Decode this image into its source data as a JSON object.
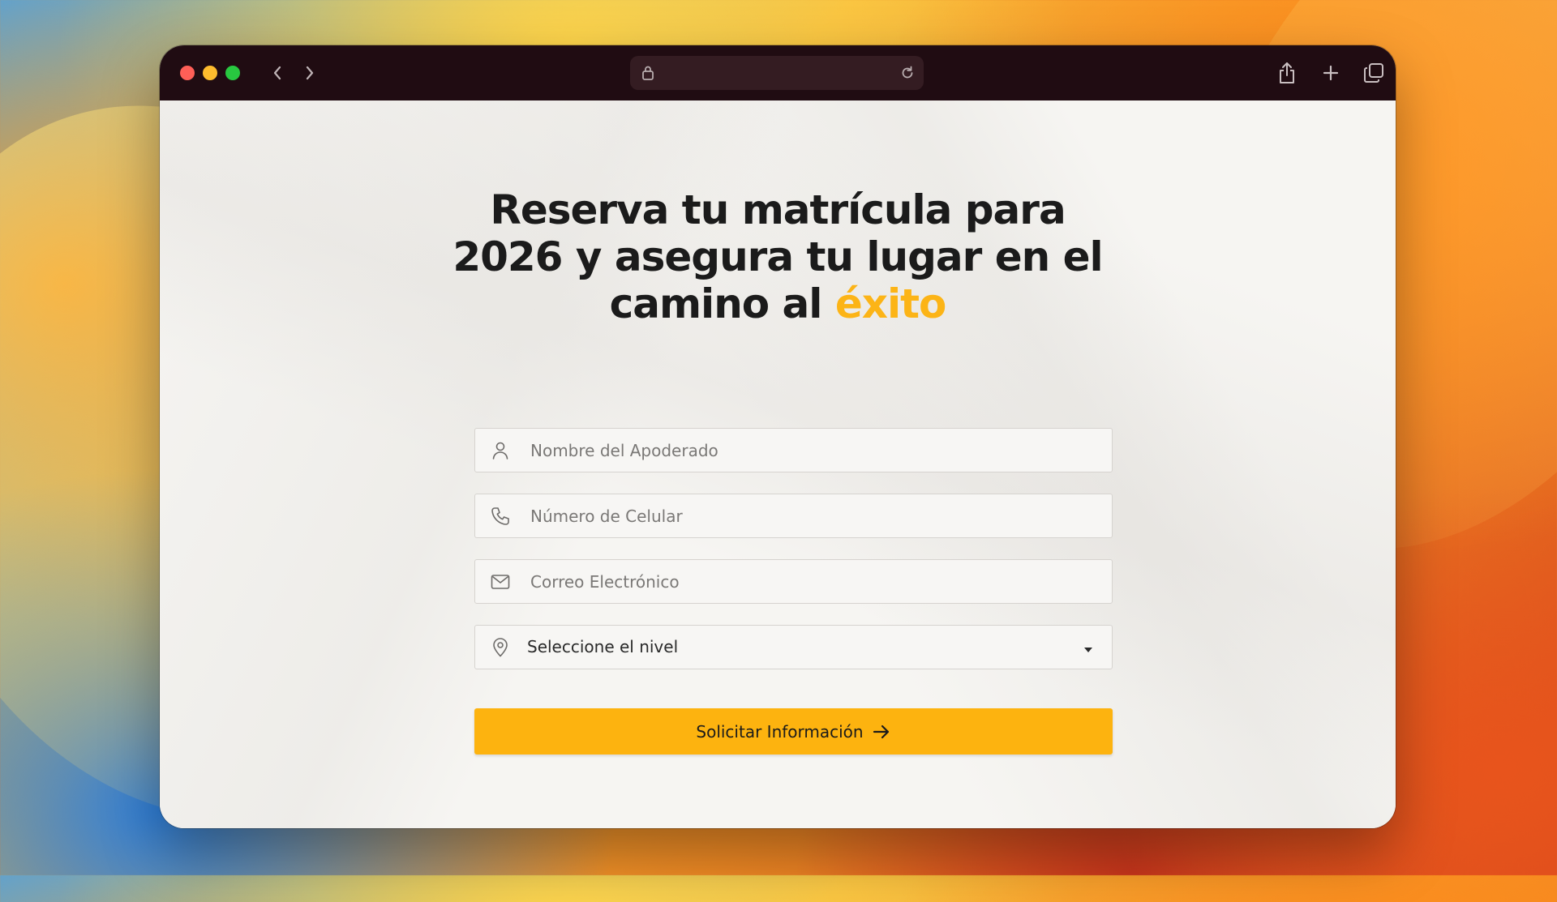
{
  "browser": {
    "url": "",
    "icons": {
      "back": "chevron-left-icon",
      "forward": "chevron-right-icon",
      "lock": "lock-icon",
      "reload": "reload-icon",
      "share": "share-icon",
      "new_tab": "plus-icon",
      "tabs": "tabs-overview-icon"
    }
  },
  "page": {
    "headline_part1": "Reserva tu matrícula para 2026 y asegura tu lugar en el camino al ",
    "headline_accent": "éxito",
    "accent_color": "#fcb416",
    "form": {
      "name": {
        "placeholder": "Nombre del Apoderado",
        "value": "",
        "icon": "user-icon"
      },
      "phone": {
        "placeholder": "Número de Celular",
        "value": "",
        "icon": "phone-icon"
      },
      "email": {
        "placeholder": "Correo Electrónico",
        "value": "",
        "icon": "mail-icon"
      },
      "level": {
        "selected": "Seleccione el nivel",
        "icon": "location-pin-icon"
      },
      "submit_label": "Solicitar Información",
      "submit_color": "#fdb30f"
    }
  }
}
